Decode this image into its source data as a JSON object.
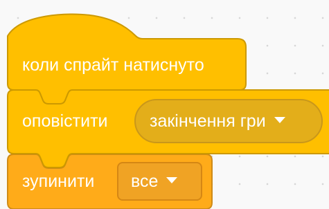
{
  "workspace": {
    "background": "#f9f9f9",
    "grid_dot_color": "#d6d6d6"
  },
  "colors": {
    "events_fill": "#ffbf00",
    "events_border": "#cc9900",
    "events_menu_fill": "#e3ae1a",
    "control_fill": "#ffab19",
    "control_border": "#cf8b17",
    "control_menu_fill": "#f0a324",
    "text": "#ffffff"
  },
  "blocks": {
    "hat": {
      "label": "коли спрайт натиснуто"
    },
    "broadcast": {
      "label": "оповістити",
      "menu_value": "закінчення гри",
      "menu_icon": "dropdown-arrow-icon"
    },
    "stop": {
      "label": "зупинити",
      "menu_value": "все",
      "menu_icon": "dropdown-arrow-icon"
    }
  }
}
